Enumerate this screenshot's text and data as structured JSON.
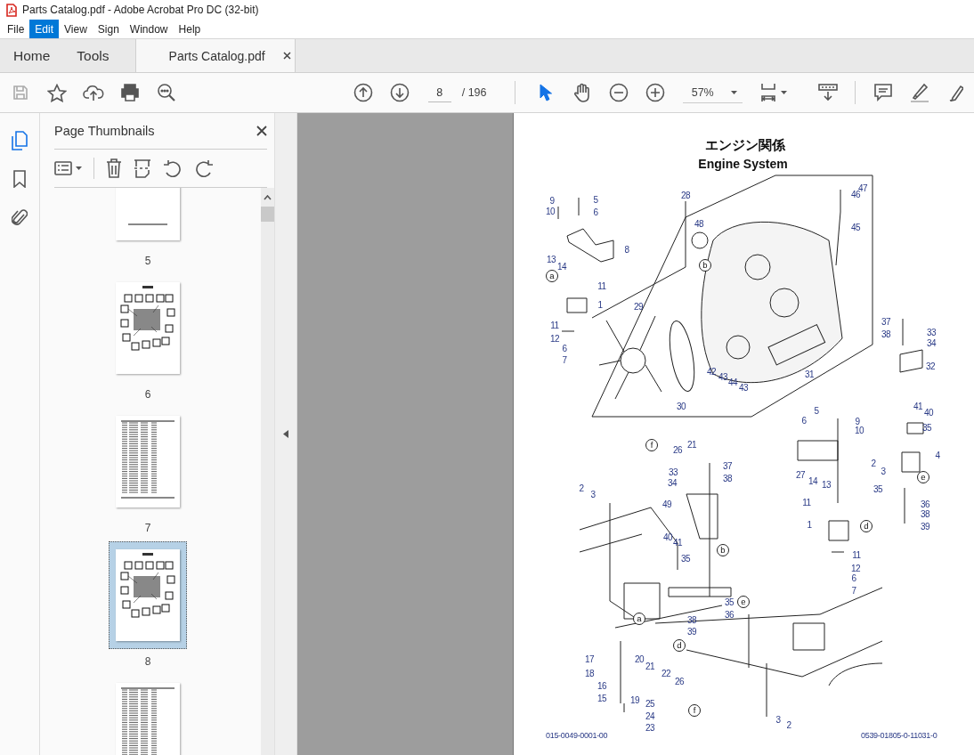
{
  "window": {
    "title": "Parts Catalog.pdf - Adobe Acrobat Pro DC (32-bit)"
  },
  "menu": [
    {
      "label": "File",
      "selected": false
    },
    {
      "label": "Edit",
      "selected": true
    },
    {
      "label": "View",
      "selected": false
    },
    {
      "label": "Sign",
      "selected": false
    },
    {
      "label": "Window",
      "selected": false
    },
    {
      "label": "Help",
      "selected": false
    }
  ],
  "tabs": [
    {
      "label": "Home",
      "selected": false
    },
    {
      "label": "Tools",
      "selected": false
    },
    {
      "label": "Parts Catalog.pdf",
      "selected": true
    }
  ],
  "toolbar": {
    "page": "8",
    "page_count": "/ 196",
    "zoom": "57%"
  },
  "sidebar": {
    "title": "Page Thumbnails",
    "thumbnails": [
      {
        "label": "5",
        "selected": false,
        "kind": "blank"
      },
      {
        "label": "6",
        "selected": false,
        "kind": "diagram"
      },
      {
        "label": "7",
        "selected": false,
        "kind": "table"
      },
      {
        "label": "8",
        "selected": true,
        "kind": "diagram"
      },
      {
        "selected": false,
        "kind": "table"
      }
    ]
  },
  "document": {
    "title_ja": "エンジン関係",
    "title_en": "Engine System",
    "callouts": [
      {
        "text": "9",
        "kind": "number"
      },
      {
        "text": "5",
        "kind": "number"
      },
      {
        "text": "10",
        "kind": "number"
      },
      {
        "text": "6",
        "kind": "number"
      },
      {
        "text": "13",
        "kind": "number"
      },
      {
        "text": "14",
        "kind": "number"
      },
      {
        "text": "8",
        "kind": "number"
      },
      {
        "text": "a",
        "kind": "letter"
      },
      {
        "text": "11",
        "kind": "number"
      },
      {
        "text": "1",
        "kind": "number"
      },
      {
        "text": "11",
        "kind": "number"
      },
      {
        "text": "12",
        "kind": "number"
      },
      {
        "text": "6",
        "kind": "number"
      },
      {
        "text": "7",
        "kind": "number"
      },
      {
        "text": "28",
        "kind": "number"
      },
      {
        "text": "48",
        "kind": "number"
      },
      {
        "text": "b",
        "kind": "letter"
      },
      {
        "text": "29",
        "kind": "number"
      },
      {
        "text": "30",
        "kind": "number"
      },
      {
        "text": "42",
        "kind": "number"
      },
      {
        "text": "43",
        "kind": "number"
      },
      {
        "text": "44",
        "kind": "number"
      },
      {
        "text": "43",
        "kind": "number"
      },
      {
        "text": "47",
        "kind": "number"
      },
      {
        "text": "46",
        "kind": "number"
      },
      {
        "text": "45",
        "kind": "number"
      },
      {
        "text": "31",
        "kind": "number"
      },
      {
        "text": "37",
        "kind": "number"
      },
      {
        "text": "38",
        "kind": "number"
      },
      {
        "text": "33",
        "kind": "number"
      },
      {
        "text": "34",
        "kind": "number"
      },
      {
        "text": "32",
        "kind": "number"
      },
      {
        "text": "41",
        "kind": "number"
      },
      {
        "text": "40",
        "kind": "number"
      },
      {
        "text": "35",
        "kind": "number"
      },
      {
        "text": "5",
        "kind": "number"
      },
      {
        "text": "6",
        "kind": "number"
      },
      {
        "text": "9",
        "kind": "number"
      },
      {
        "text": "10",
        "kind": "number"
      },
      {
        "text": "f",
        "kind": "letter"
      },
      {
        "text": "21",
        "kind": "number"
      },
      {
        "text": "26",
        "kind": "number"
      },
      {
        "text": "4",
        "kind": "number"
      },
      {
        "text": "2",
        "kind": "number"
      },
      {
        "text": "3",
        "kind": "number"
      },
      {
        "text": "e",
        "kind": "letter"
      },
      {
        "text": "27",
        "kind": "number"
      },
      {
        "text": "14",
        "kind": "number"
      },
      {
        "text": "13",
        "kind": "number"
      },
      {
        "text": "33",
        "kind": "number"
      },
      {
        "text": "37",
        "kind": "number"
      },
      {
        "text": "34",
        "kind": "number"
      },
      {
        "text": "38",
        "kind": "number"
      },
      {
        "text": "2",
        "kind": "number"
      },
      {
        "text": "3",
        "kind": "number"
      },
      {
        "text": "35",
        "kind": "number"
      },
      {
        "text": "36",
        "kind": "number"
      },
      {
        "text": "38",
        "kind": "number"
      },
      {
        "text": "39",
        "kind": "number"
      },
      {
        "text": "49",
        "kind": "number"
      },
      {
        "text": "11",
        "kind": "number"
      },
      {
        "text": "1",
        "kind": "number"
      },
      {
        "text": "d",
        "kind": "letter"
      },
      {
        "text": "40",
        "kind": "number"
      },
      {
        "text": "41",
        "kind": "number"
      },
      {
        "text": "b",
        "kind": "letter"
      },
      {
        "text": "35",
        "kind": "number"
      },
      {
        "text": "11",
        "kind": "number"
      },
      {
        "text": "12",
        "kind": "number"
      },
      {
        "text": "6",
        "kind": "number"
      },
      {
        "text": "7",
        "kind": "number"
      },
      {
        "text": "35",
        "kind": "number"
      },
      {
        "text": "e",
        "kind": "letter"
      },
      {
        "text": "36",
        "kind": "number"
      },
      {
        "text": "38",
        "kind": "number"
      },
      {
        "text": "39",
        "kind": "number"
      },
      {
        "text": "a",
        "kind": "letter"
      },
      {
        "text": "d",
        "kind": "letter"
      },
      {
        "text": "17",
        "kind": "number"
      },
      {
        "text": "18",
        "kind": "number"
      },
      {
        "text": "20",
        "kind": "number"
      },
      {
        "text": "21",
        "kind": "number"
      },
      {
        "text": "22",
        "kind": "number"
      },
      {
        "text": "26",
        "kind": "number"
      },
      {
        "text": "19",
        "kind": "number"
      },
      {
        "text": "16",
        "kind": "number"
      },
      {
        "text": "15",
        "kind": "number"
      },
      {
        "text": "25",
        "kind": "number"
      },
      {
        "text": "f",
        "kind": "letter"
      },
      {
        "text": "24",
        "kind": "number"
      },
      {
        "text": "23",
        "kind": "number"
      },
      {
        "text": "3",
        "kind": "number"
      },
      {
        "text": "2",
        "kind": "number"
      }
    ],
    "footer_left": "015-0049-0001-00",
    "footer_right": "0539-01805-0-11031-0"
  }
}
